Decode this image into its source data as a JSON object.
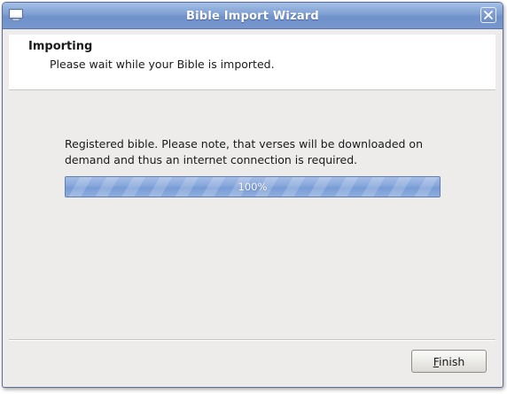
{
  "window": {
    "title": "Bible Import Wizard",
    "icons": {
      "app": "window-app-icon",
      "close": "close-icon"
    }
  },
  "header": {
    "title": "Importing",
    "subtitle": "Please wait while your Bible is imported."
  },
  "content": {
    "message": "Registered bible. Please note, that verses will be downloaded on demand and thus an internet connection is required.",
    "progress": {
      "percent": 100,
      "label": "100%"
    }
  },
  "footer": {
    "finish_mnemonic": "F",
    "finish_rest": "inish"
  },
  "colors": {
    "titlebar": "#7f9fd3",
    "progress_fill": "#86a6db",
    "background": "#edecea"
  }
}
